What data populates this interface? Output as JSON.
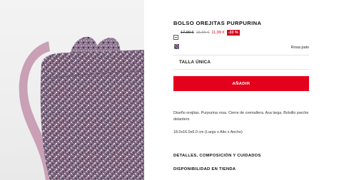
{
  "product": {
    "title": "BOLSO OREJITAS PURPURINA",
    "price": {
      "original": "17,99 €",
      "previous": "15,99 €",
      "current": "11,99 €",
      "discount": "-33 %"
    },
    "color": {
      "name": "Rosa palo",
      "swatch_colors": [
        "#6b5f7e",
        "#a58a9e",
        "#3f3a4f"
      ]
    },
    "size": "TALLA ÚNICA",
    "add_button": "AÑADIR",
    "description": "Diseño orejitas. Purpurina rosa. Cierre de cremallera. Asa larga. Bolsillo parche delantero",
    "dimensions": "18.0x16.0x6.0 cm (Largo x Alto x Ancho)"
  },
  "sections": {
    "details": "DETALLES, COMPOSICIÓN Y CUIDADOS",
    "availability": "DISPONIBILIDAD EN TIENDA"
  },
  "icons": {
    "price_info": "price-info-icon"
  },
  "colors": {
    "accent": "#e4011c",
    "discount": "#d0021b"
  }
}
